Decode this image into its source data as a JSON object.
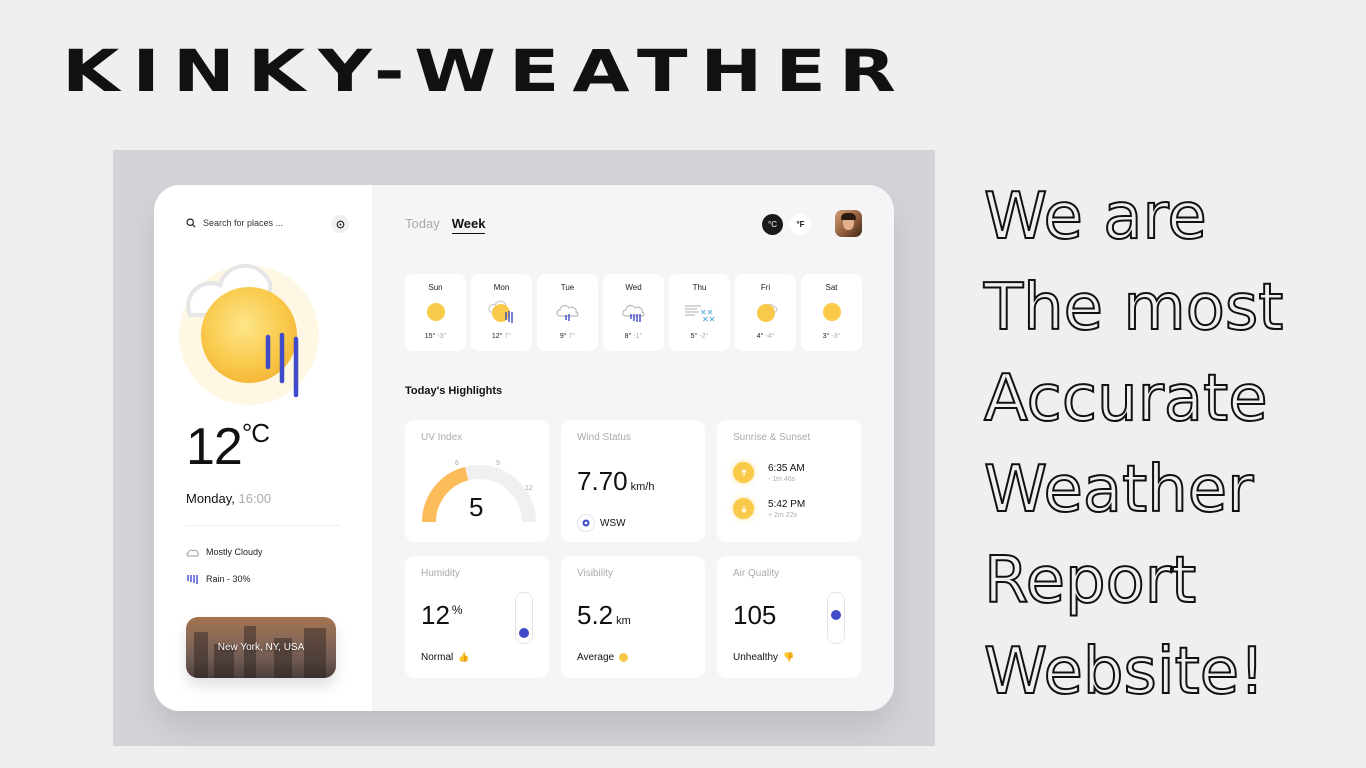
{
  "brand": "KINKY-WEATHER",
  "slogan": [
    "We are",
    "The most",
    "Accurate",
    "Weather",
    "Report",
    "Website!"
  ],
  "sidebar": {
    "search_placeholder": "Search for places ...",
    "temperature": "12",
    "temperature_unit": "°C",
    "day": "Monday,",
    "time": "16:00",
    "condition": "Mostly Cloudy",
    "rain": "Rain - 30%",
    "city": "New York, NY, USA"
  },
  "tabs": {
    "today": "Today",
    "week": "Week"
  },
  "units": {
    "celsius": "°C",
    "fahrenheit": "°F"
  },
  "week": [
    {
      "day": "Sun",
      "icon": "sun-icon",
      "high": "15°",
      "low": "-3°"
    },
    {
      "day": "Mon",
      "icon": "cloud-sun-rain-icon",
      "high": "12°",
      "low": "7°"
    },
    {
      "day": "Tue",
      "icon": "cloud-rain-icon",
      "high": "9°",
      "low": "7°"
    },
    {
      "day": "Wed",
      "icon": "cloud-rain-icon",
      "high": "8°",
      "low": "-1°"
    },
    {
      "day": "Thu",
      "icon": "wind-snow-icon",
      "high": "5°",
      "low": "-2°"
    },
    {
      "day": "Fri",
      "icon": "cloud-sun-icon",
      "high": "4°",
      "low": "-4°"
    },
    {
      "day": "Sat",
      "icon": "sun-icon",
      "high": "3°",
      "low": "-3°"
    }
  ],
  "highlights": {
    "title": "Today's Highlights",
    "uv": {
      "label": "UV Index",
      "value": "5",
      "scale": [
        "6",
        "9",
        "12"
      ],
      "level": 0.42
    },
    "wind": {
      "label": "Wind Status",
      "value": "7.70",
      "unit": "km/h",
      "direction": "WSW"
    },
    "sun": {
      "label": "Sunrise & Sunset",
      "sunrise": "6:35 AM",
      "sunrise_delta": "- 1m 46s",
      "sunset": "5:42 PM",
      "sunset_delta": "+ 2m 22s"
    },
    "humidity": {
      "label": "Humidity",
      "value": "12",
      "unit": "%",
      "status": "Normal",
      "level": 0.12
    },
    "visibility": {
      "label": "Visibility",
      "value": "5.2",
      "unit": "km",
      "status": "Average"
    },
    "air": {
      "label": "Air Quality",
      "value": "105",
      "status": "Unhealthy",
      "level": 0.6
    }
  },
  "colors": {
    "accent_blue": "#3f4bc9",
    "sun_yellow": "#f9c94a",
    "uv_fill": "#fdbc5a"
  }
}
